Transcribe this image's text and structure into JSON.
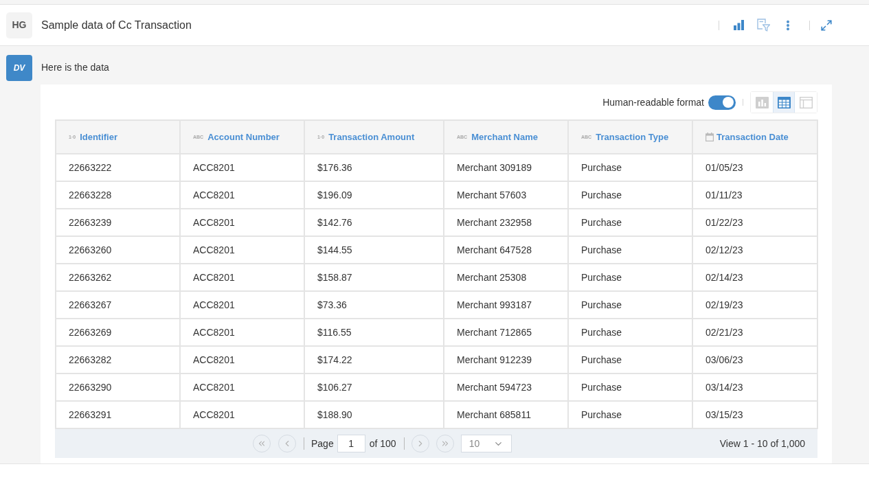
{
  "conversation_header": {
    "avatar": "HG",
    "title": "Sample data of Cc Transaction"
  },
  "message": {
    "avatar": "DV",
    "text": "Here is the data"
  },
  "data_view": {
    "human_readable": {
      "label": "Human-readable format",
      "on": true
    },
    "view_modes": [
      {
        "kind": "chart",
        "selected": false
      },
      {
        "kind": "table",
        "selected": true
      },
      {
        "kind": "layout",
        "selected": false
      }
    ],
    "table": {
      "columns": [
        {
          "kind": "number",
          "type_label": "1·0",
          "label": "Identifier"
        },
        {
          "kind": "text",
          "type_label": "ABC",
          "label": "Account Number"
        },
        {
          "kind": "number",
          "type_label": "1·0",
          "label": "Transaction Amount"
        },
        {
          "kind": "text",
          "type_label": "ABC",
          "label": "Merchant Name"
        },
        {
          "kind": "text",
          "type_label": "ABC",
          "label": "Transaction Type"
        },
        {
          "kind": "date",
          "label": "Transaction Date"
        }
      ],
      "rows": [
        [
          "22663222",
          "ACC8201",
          "$176.36",
          "Merchant 309189",
          "Purchase",
          "01/05/23"
        ],
        [
          "22663228",
          "ACC8201",
          "$196.09",
          "Merchant 57603",
          "Purchase",
          "01/11/23"
        ],
        [
          "22663239",
          "ACC8201",
          "$142.76",
          "Merchant 232958",
          "Purchase",
          "01/22/23"
        ],
        [
          "22663260",
          "ACC8201",
          "$144.55",
          "Merchant 647528",
          "Purchase",
          "02/12/23"
        ],
        [
          "22663262",
          "ACC8201",
          "$158.87",
          "Merchant 25308",
          "Purchase",
          "02/14/23"
        ],
        [
          "22663267",
          "ACC8201",
          "$73.36",
          "Merchant 993187",
          "Purchase",
          "02/19/23"
        ],
        [
          "22663269",
          "ACC8201",
          "$116.55",
          "Merchant 712865",
          "Purchase",
          "02/21/23"
        ],
        [
          "22663282",
          "ACC8201",
          "$174.22",
          "Merchant 912239",
          "Purchase",
          "03/06/23"
        ],
        [
          "22663290",
          "ACC8201",
          "$106.27",
          "Merchant 594723",
          "Purchase",
          "03/14/23"
        ],
        [
          "22663291",
          "ACC8201",
          "$188.90",
          "Merchant 685811",
          "Purchase",
          "03/15/23"
        ]
      ]
    },
    "pagination": {
      "page_label": "Page",
      "page": "1",
      "of_label": "of 100",
      "page_size": "10",
      "summary": "View 1 - 10 of 1,000"
    }
  }
}
